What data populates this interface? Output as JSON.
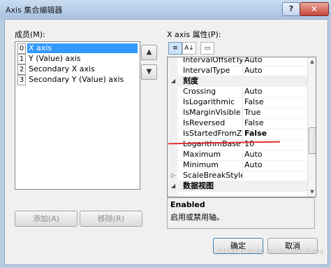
{
  "window": {
    "title": "Axis 集合编辑器",
    "help_glyph": "?",
    "close_glyph": "✕"
  },
  "members": {
    "label": "成员(M):",
    "items": [
      {
        "index": "0",
        "name": "X axis",
        "selected": true
      },
      {
        "index": "1",
        "name": "Y (Value) axis",
        "selected": false
      },
      {
        "index": "2",
        "name": "Secondary X axis",
        "selected": false
      },
      {
        "index": "3",
        "name": "Secondary Y (Value) axis",
        "selected": false
      }
    ],
    "up_glyph": "▲",
    "down_glyph": "▼",
    "add_label": "添加(A)",
    "remove_label": "移除(R)"
  },
  "properties": {
    "label": "X axis 属性(P):",
    "toolbar": {
      "categorized": "≡",
      "alphabetical": "A↓",
      "pages": "▭"
    },
    "rows": [
      {
        "kind": "prop",
        "name": "IntervalOffsetTyp",
        "value": "Auto"
      },
      {
        "kind": "prop",
        "name": "IntervalType",
        "value": "Auto"
      },
      {
        "kind": "cat",
        "name": "刻度",
        "expander": "◢"
      },
      {
        "kind": "prop",
        "name": "Crossing",
        "value": "Auto"
      },
      {
        "kind": "prop",
        "name": "IsLogarithmic",
        "value": "False"
      },
      {
        "kind": "prop",
        "name": "IsMarginVisible",
        "value": "True"
      },
      {
        "kind": "prop",
        "name": "IsReversed",
        "value": "False"
      },
      {
        "kind": "prop",
        "name": "IsStartedFromZer",
        "value": "False",
        "bold": true
      },
      {
        "kind": "prop",
        "name": "LogarithmBase",
        "value": "10"
      },
      {
        "kind": "prop",
        "name": "Maximum",
        "value": "Auto"
      },
      {
        "kind": "prop",
        "name": "Minimum",
        "value": "Auto"
      },
      {
        "kind": "prop",
        "name": "ScaleBreakStyle",
        "value": "",
        "expander": "▷"
      },
      {
        "kind": "cat",
        "name": "数据视图",
        "expander": "◢"
      }
    ],
    "description": {
      "title": "Enabled",
      "text": "启用或禁用轴。"
    }
  },
  "buttons": {
    "ok": "确定",
    "cancel": "取消"
  },
  "watermark": "http://blog.csdn.net/Feng_807"
}
